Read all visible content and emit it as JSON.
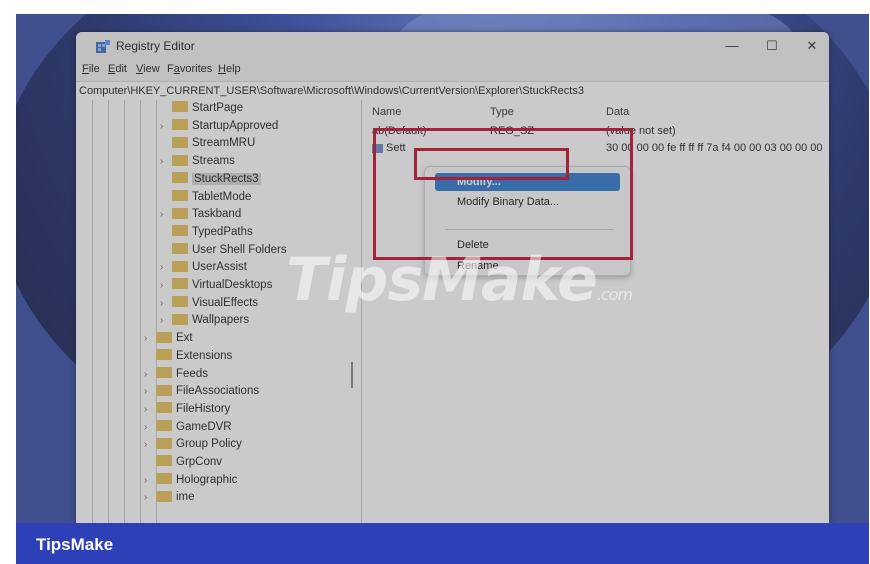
{
  "window": {
    "title": "Registry Editor",
    "controls": [
      "—",
      "☐",
      "✕"
    ]
  },
  "menubar": [
    "File",
    "Edit",
    "View",
    "Favorites",
    "Help"
  ],
  "address": "Computer\\HKEY_CURRENT_USER\\Software\\Microsoft\\Windows\\CurrentVersion\\Explorer\\StuckRects3",
  "tree": [
    {
      "label": "StartPage",
      "chevron": false
    },
    {
      "label": "StartupApproved",
      "chevron": true
    },
    {
      "label": "StreamMRU",
      "chevron": false
    },
    {
      "label": "Streams",
      "chevron": true
    },
    {
      "label": "StuckRects3",
      "chevron": false,
      "selected": true
    },
    {
      "label": "TabletMode",
      "chevron": false
    },
    {
      "label": "Taskband",
      "chevron": true
    },
    {
      "label": "TypedPaths",
      "chevron": false
    },
    {
      "label": "User Shell Folders",
      "chevron": false
    },
    {
      "label": "UserAssist",
      "chevron": true
    },
    {
      "label": "VirtualDesktops",
      "chevron": true
    },
    {
      "label": "VisualEffects",
      "chevron": true
    },
    {
      "label": "Wallpapers",
      "chevron": true
    },
    {
      "label": "Ext",
      "chevron": true
    },
    {
      "label": "Extensions",
      "chevron": false
    },
    {
      "label": "Feeds",
      "chevron": true
    },
    {
      "label": "FileAssociations",
      "chevron": true
    },
    {
      "label": "FileHistory",
      "chevron": true
    },
    {
      "label": "GameDVR",
      "chevron": true
    },
    {
      "label": "Group Policy",
      "chevron": true
    },
    {
      "label": "GrpConv",
      "chevron": false
    },
    {
      "label": "Holographic",
      "chevron": true
    },
    {
      "label": "ime",
      "chevron": true
    }
  ],
  "values": {
    "columns": {
      "name": "Name",
      "type": "Type",
      "data": "Data"
    },
    "rows": [
      {
        "name": "ab(Default)",
        "type": "REG_SZ",
        "data": "(value not set)"
      },
      {
        "name": "Sett",
        "type": "",
        "data": "30 00 00 00 fe ff ff ff 7a f4 00 00 03 00 00 00"
      }
    ]
  },
  "context_menu": {
    "modify": "Modify...",
    "modify_binary": "Modify Binary Data...",
    "delete": "Delete",
    "rename": "Rename"
  },
  "watermark": {
    "main": "TipsMake",
    "suffix": ".com"
  },
  "footer": {
    "brand": "TipsMake"
  },
  "colors": {
    "accent": "#2f7ad1",
    "highlight_box": "#c8102e",
    "footer": "#2e40b7"
  }
}
